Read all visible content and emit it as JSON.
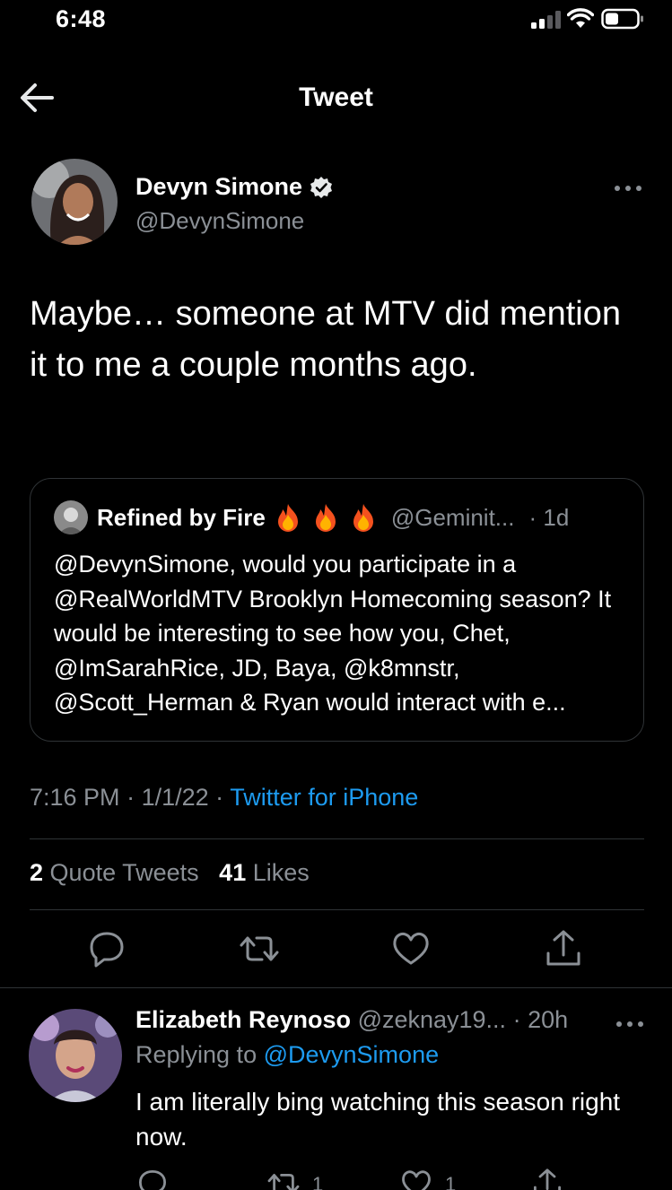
{
  "status_bar": {
    "time": "6:48"
  },
  "nav": {
    "title": "Tweet",
    "back_icon": "arrow-left-icon"
  },
  "main_tweet": {
    "author_name": "Devyn Simone",
    "author_handle": "@DevynSimone",
    "text": "Maybe… someone at MTV did mention it to me a couple months ago.",
    "quoted": {
      "author_name": "Refined by Fire",
      "author_handle": "@Geminit...",
      "time": "· 1d",
      "text": "@DevynSimone, would you participate in a @RealWorldMTV Brooklyn Homecoming season? It would be interesting to see how you, Chet, @ImSarahRice, JD, Baya, @k8mnstr, @Scott_Herman & Ryan would interact with e..."
    },
    "time": "7:16 PM",
    "date": "1/1/22",
    "source": "Twitter for iPhone",
    "quote_tweets_count": "2",
    "quote_tweets_label": "Quote Tweets",
    "likes_count": "41",
    "likes_label": "Likes"
  },
  "reply": {
    "author_name": "Elizabeth Reynoso",
    "author_handle": "@zeknay19...",
    "time": "· 20h",
    "replying_prefix": "Replying to",
    "replying_to": "@DevynSimone",
    "text": "I am literally bing watching this season right now.",
    "retweet_count": "1",
    "like_count": "1"
  },
  "colors": {
    "background": "#000000",
    "accent": "#1d9bf0",
    "muted": "#8b9096",
    "divider": "#2f3336"
  }
}
